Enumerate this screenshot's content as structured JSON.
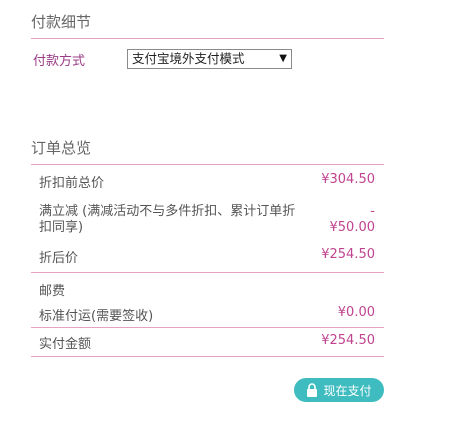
{
  "payment": {
    "title": "付款细节",
    "method_label": "付款方式",
    "method_selected": "支付宝境外支付模式"
  },
  "summary": {
    "title": "订单总览",
    "rows": [
      {
        "label": "折扣前总价",
        "value": "¥304.50"
      },
      {
        "label": "满立减 (满减活动不与多件折扣、累计订单折扣同享)",
        "value": "-\n¥50.00"
      },
      {
        "label": "折后价",
        "value": "¥254.50"
      },
      {
        "label": "邮费",
        "value": ""
      },
      {
        "label": "标准付运(需要签收)",
        "value": "¥0.00"
      },
      {
        "label": "实付金额",
        "value": "¥254.50"
      }
    ]
  },
  "actions": {
    "pay_label": "现在支付",
    "pay_icon": "lock-icon"
  },
  "colors": {
    "accent_pink": "#c0448f",
    "divider_pink": "#e7a0c6",
    "button_teal": "#3fbcc0"
  }
}
